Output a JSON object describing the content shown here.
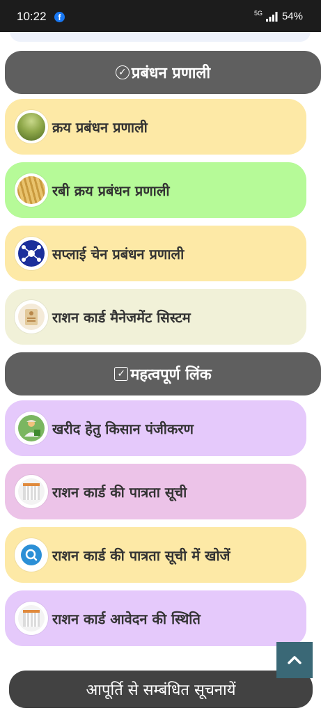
{
  "status_bar": {
    "time": "10:22",
    "notification_icon": "facebook-icon",
    "network": "5G",
    "battery": "54%"
  },
  "sections": [
    {
      "title": "प्रबंधन प्रणाली",
      "icon": "check-circle-icon",
      "items": [
        {
          "label": "क्रय प्रबंधन प्रणाली",
          "bg": "#fde9a6",
          "icon": "paddy-field-icon"
        },
        {
          "label": "रबी क्रय प्रबंधन प्रणाली",
          "bg": "#b6fa98",
          "icon": "wheat-icon"
        },
        {
          "label": "सप्लाई चेन प्रबंधन प्रणाली",
          "bg": "#fde9a6",
          "icon": "network-globe-icon"
        },
        {
          "label": "राशन कार्ड मैनेजमेंट सिस्टम",
          "bg": "#f1f1d8",
          "icon": "ration-card-icon"
        }
      ]
    },
    {
      "title": "महत्वपूर्ण लिंक",
      "icon": "check-square-icon",
      "items": [
        {
          "label": "खरीद हेतु किसान पंजीकरण",
          "bg": "#e5c9fb",
          "icon": "farmer-icon"
        },
        {
          "label": "राशन कार्ड की पात्रता सूची",
          "bg": "#ecc3e8",
          "icon": "document-list-icon"
        },
        {
          "label": "राशन कार्ड की पात्रता सूची में खोजें",
          "bg": "#fde9a6",
          "icon": "search-icon"
        },
        {
          "label": "राशन कार्ड आवेदन की स्थिति",
          "bg": "#e5c9fb",
          "icon": "document-list-icon"
        }
      ]
    }
  ],
  "scroll_top": {
    "icon": "chevron-up-icon"
  },
  "bottom_bar": {
    "label": "आपूर्ति से सम्बंधित सूचनायें"
  }
}
